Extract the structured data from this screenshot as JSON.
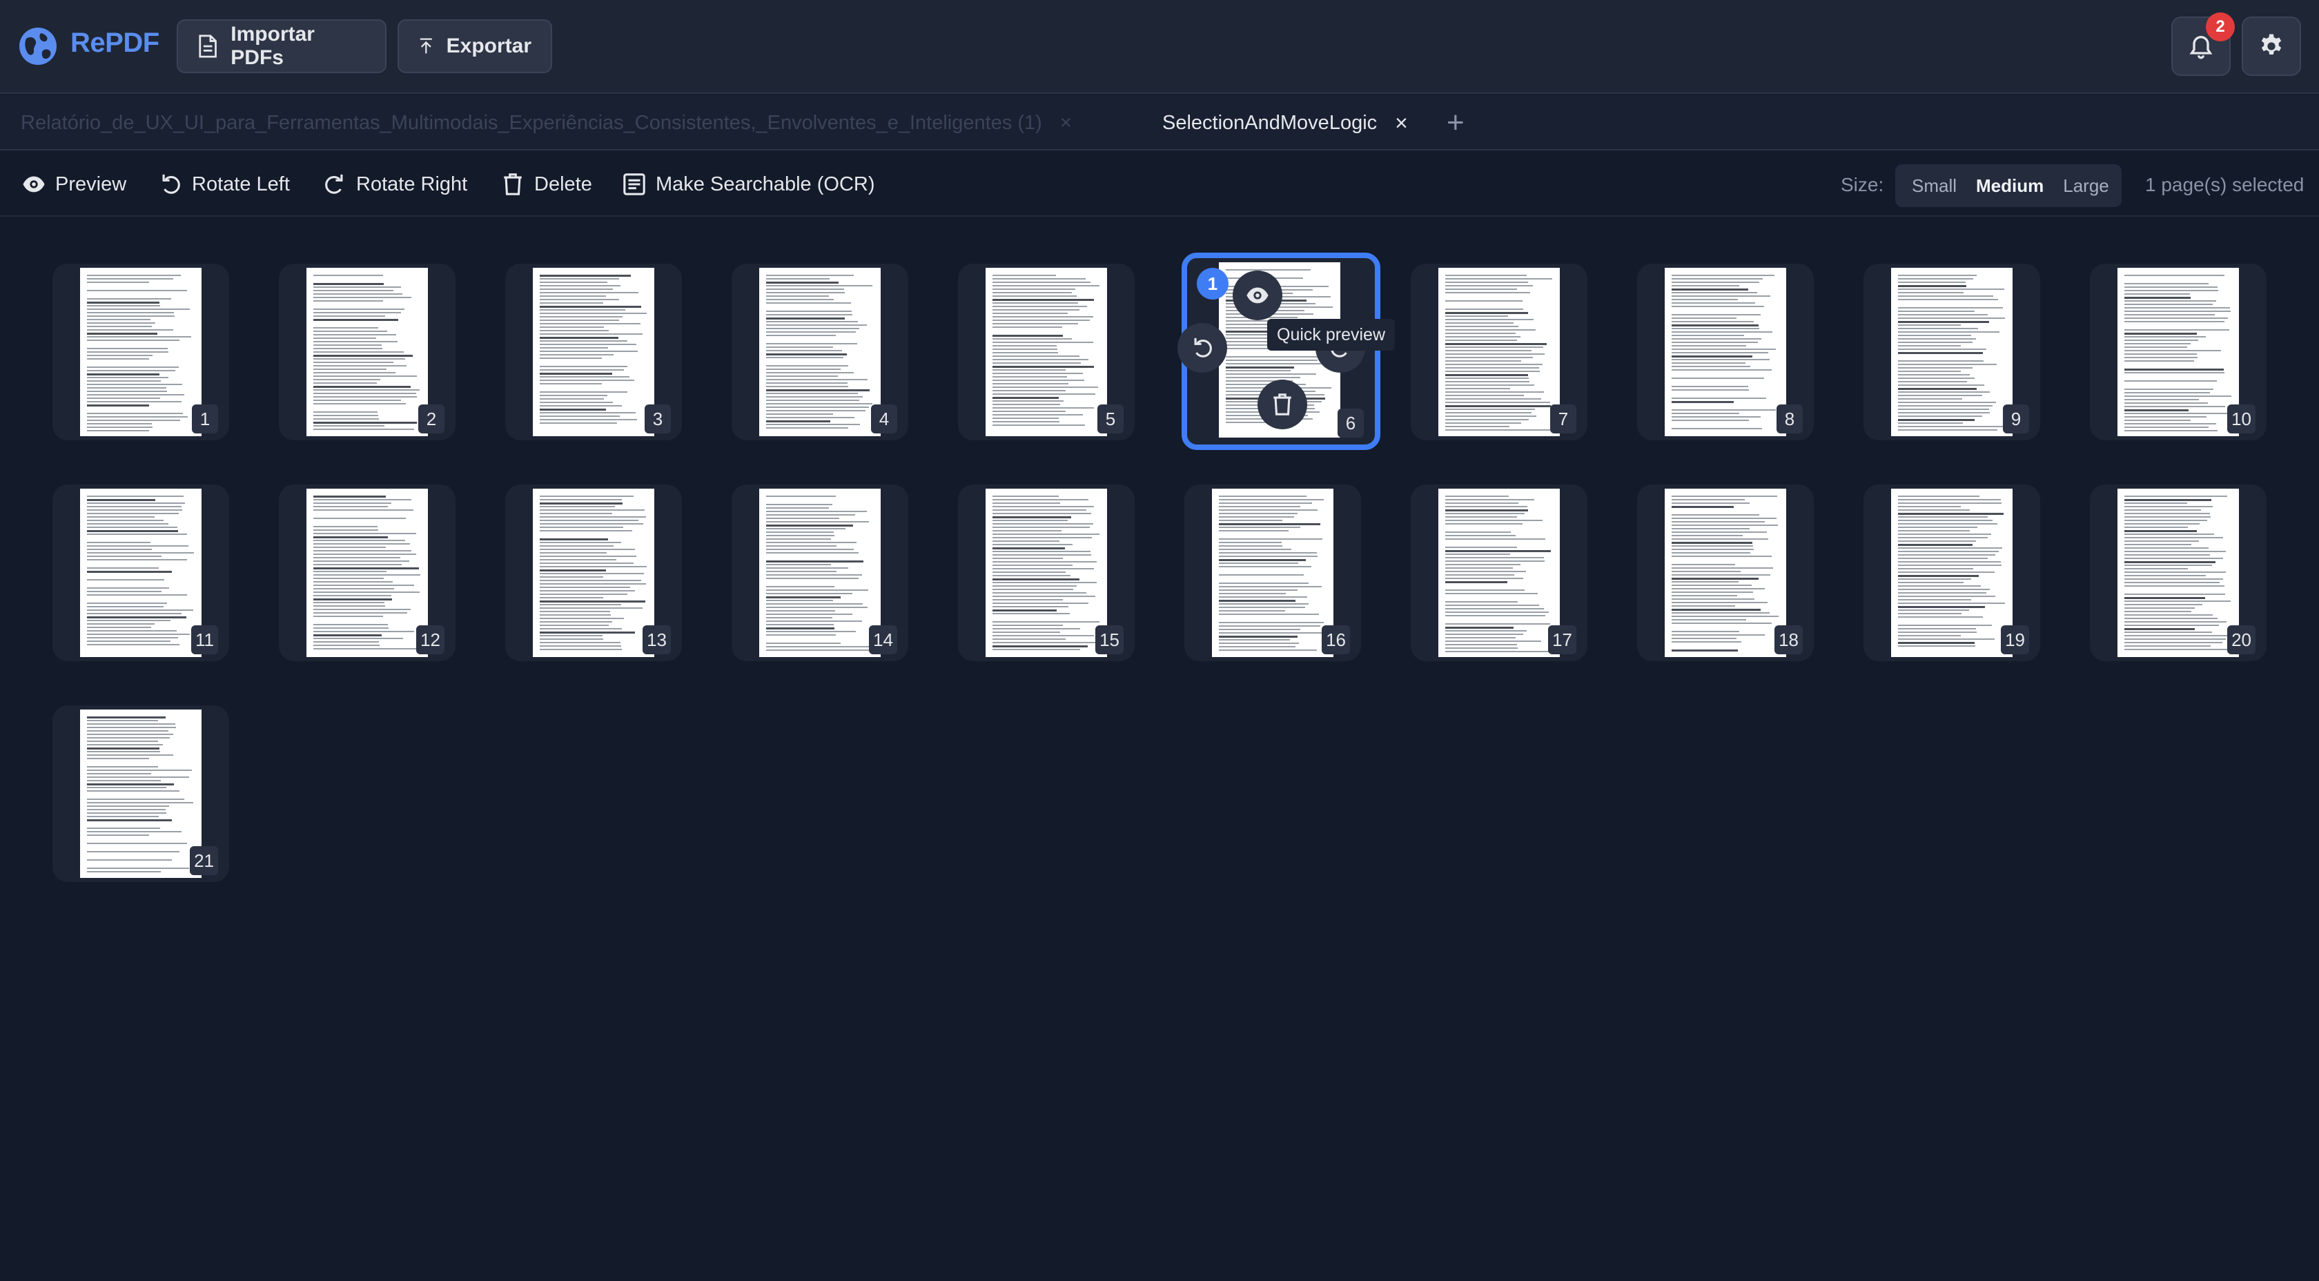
{
  "app": {
    "name": "RePDF",
    "import_label": "Importar PDFs",
    "export_label": "Exportar",
    "notification_count": "2"
  },
  "tabs": {
    "inactive_label": "Relatório_de_UX_UI_para_Ferramentas_Multimodais_Experiências_Consistentes,_Envolventes_e_Inteligentes (1)",
    "inactive_close": "×",
    "active_label": "SelectionAndMoveLogic",
    "active_close": "×",
    "add_label": "+"
  },
  "toolbar": {
    "preview": "Preview",
    "rotate_left": "Rotate Left",
    "rotate_right": "Rotate Right",
    "delete": "Delete",
    "ocr": "Make Searchable (OCR)",
    "size_label": "Size:",
    "sizes": [
      "Small",
      "Medium",
      "Large"
    ],
    "selected_size": "Medium",
    "selection_status": "1 page(s) selected"
  },
  "pages": {
    "count": 21,
    "selected": 6,
    "labels": [
      "1",
      "2",
      "3",
      "4",
      "5",
      "6",
      "7",
      "8",
      "9",
      "10",
      "11",
      "12",
      "13",
      "14",
      "15",
      "16",
      "17",
      "18",
      "19",
      "20",
      "21"
    ],
    "selection_order": "1",
    "tooltip": "Quick preview"
  },
  "colors": {
    "background": "#131a2a",
    "header": "#1e2535",
    "accent": "#3f7df5",
    "brand": "#5b8def",
    "badge": "#e23b3b"
  },
  "icons": {
    "logo": "globe-icon",
    "import": "document-icon",
    "export": "upload-icon",
    "notifications": "bell-icon",
    "settings": "gear-icon",
    "preview": "eye-icon",
    "rotate_left": "rotate-left-icon",
    "rotate_right": "rotate-right-icon",
    "delete": "trash-icon",
    "ocr": "scan-text-icon"
  }
}
